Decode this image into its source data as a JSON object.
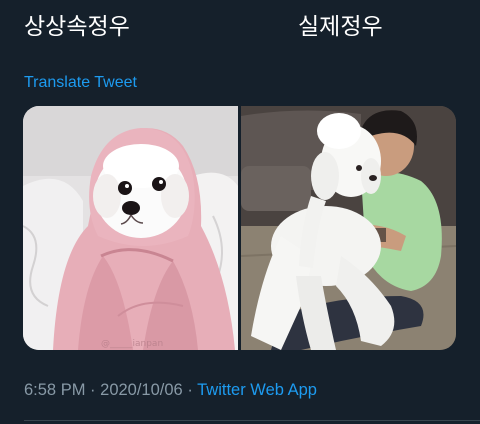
{
  "tweet": {
    "caption_left": "상상속정우",
    "caption_right": "실제정우",
    "translate_label": "Translate Tweet",
    "time": "6:58 PM",
    "separator": "·",
    "date": "2020/10/06",
    "source": "Twitter Web App"
  },
  "media": [
    {
      "icon": "puppy-in-pink-towel-photo",
      "watermark": "@_____ianpan"
    },
    {
      "icon": "man-hugging-white-poodle-photo"
    }
  ],
  "colors": {
    "background": "#15202b",
    "text": "#ffffff",
    "link": "#1d9bf0",
    "muted": "#8899a6",
    "divider": "#38444d"
  }
}
